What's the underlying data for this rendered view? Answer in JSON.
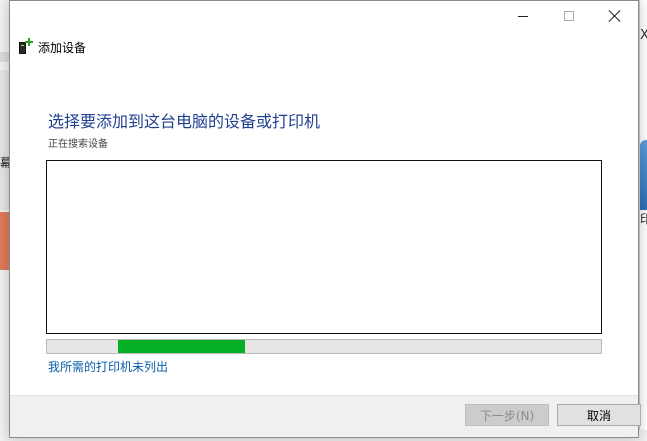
{
  "window": {
    "title": "添加设备",
    "controls": {
      "minimize": "minimize",
      "maximize": "maximize",
      "close": "close"
    }
  },
  "dialog": {
    "heading": "选择要添加到这台电脑的设备或打印机",
    "status": "正在搜索设备",
    "progress_fraction": 0.23,
    "printer_link": "我所需的打印机未列出",
    "buttons": {
      "next": "下一步(N)",
      "cancel": "取消"
    }
  },
  "background": {
    "left_fragment": "幕",
    "right_fragment_top": "X",
    "right_fragment_mid": "印"
  },
  "colors": {
    "heading": "#1f3f8f",
    "link": "#0a5ea8",
    "progress": "#06b025"
  }
}
